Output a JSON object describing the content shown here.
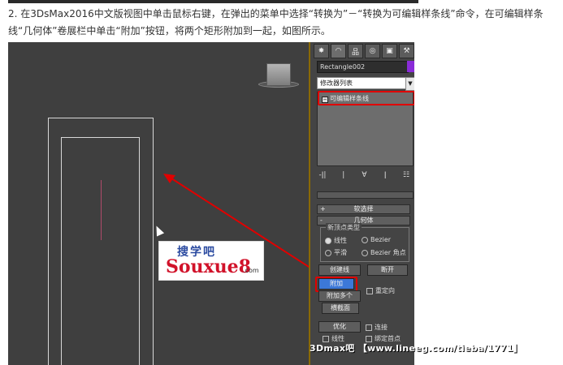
{
  "intro": {
    "text": "2. 在3DsMax2016中文版视图中单击鼠标右键，在弹出的菜单中选择“转换为”－“转换为可编辑样条线”命令，在可编辑样条线“几何体”卷展栏中单击“附加”按钮，将两个矩形附加到一起，如图所示。"
  },
  "logo": {
    "line1": "搜学吧",
    "line2": "Souxue8",
    "suffix": ".com"
  },
  "panel": {
    "tabs": [
      {
        "icon": "create-icon",
        "glyph": "✸"
      },
      {
        "icon": "modify-icon",
        "glyph": "◠"
      },
      {
        "icon": "hierarchy-icon",
        "glyph": "品"
      },
      {
        "icon": "motion-icon",
        "glyph": "◎"
      },
      {
        "icon": "display-icon",
        "glyph": "▣"
      },
      {
        "icon": "utilities-icon",
        "glyph": "⚒"
      }
    ],
    "object_name": "Rectangle002",
    "object_color": "#8a2bd8",
    "modifier_list": "修改器列表",
    "stack_item": "可编辑样条线",
    "stack_tools": [
      "-ǀ|",
      "|",
      "∀",
      "ǀ",
      "☷"
    ],
    "rollout_soft": "软选择",
    "rollout_geometry": "几何体",
    "new_vertex_type": "新顶点类型",
    "radio_linear": "线性",
    "radio_bezier": "Bezier",
    "radio_smooth": "平滑",
    "radio_bezier_corner": "Bezier 角点",
    "btn_create_line": "创建线",
    "btn_break": "断开",
    "btn_attach": "附加",
    "chk_reorient": "重定向",
    "btn_attach_mult": "附加多个",
    "btn_cross_section": "横截面",
    "btn_refine": "优化",
    "chk_connect": "连接",
    "chk_linear": "线性",
    "chk_bind_first": "绑定首点",
    "accent_highlight": "#e00000",
    "active_button": "#3c78d8"
  },
  "watermark": "3Dmax吧 【www.lineeg.com/tieba/1771】"
}
